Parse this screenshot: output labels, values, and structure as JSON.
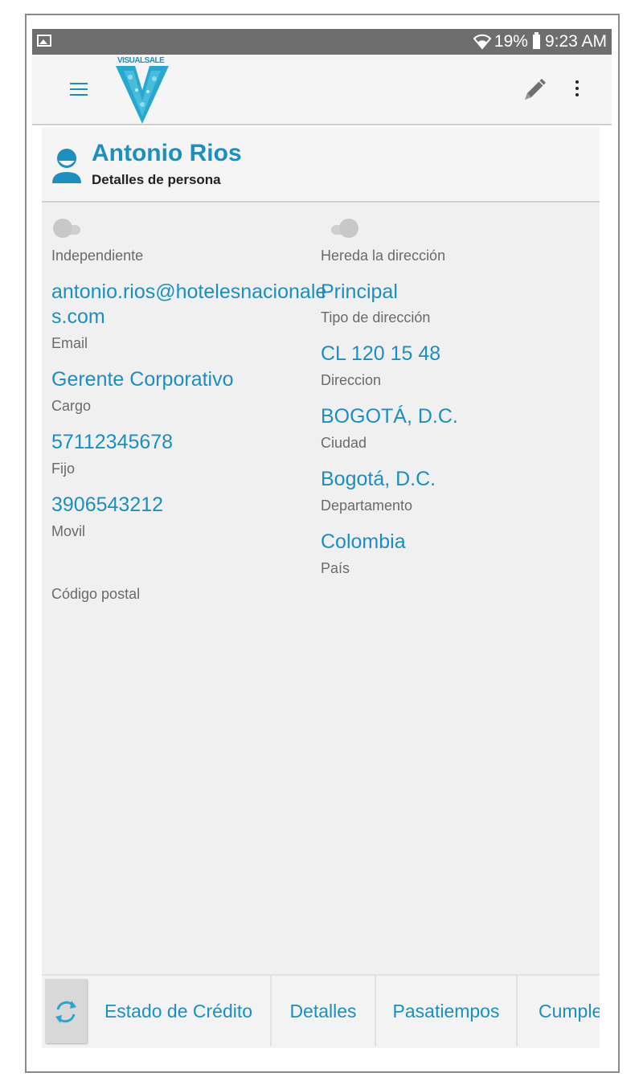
{
  "status_bar": {
    "battery_percent": "19%",
    "time": "9:23 AM"
  },
  "app_bar": {
    "logo_text": "VISUALSALE",
    "menu_icon": "hamburger-menu-icon",
    "edit_icon": "pencil-icon",
    "overflow_icon": "more-vert-icon"
  },
  "person": {
    "name": "Antonio Rios",
    "subtitle": "Detalles de persona"
  },
  "left_column": {
    "independiente_label": "Independiente",
    "independiente_on": false,
    "email_line1": "antonio.rios@hotelesnacionale",
    "email_line2": "s.com",
    "email_label": "Email",
    "cargo_value": "Gerente Corporativo",
    "cargo_label": "Cargo",
    "fijo_value": "57112345678",
    "fijo_label": "Fijo",
    "movil_value": "3906543212",
    "movil_label": "Movil",
    "codigo_postal_value": "",
    "codigo_postal_label": "Código postal"
  },
  "right_column": {
    "hereda_label": "Hereda la dirección",
    "hereda_on": false,
    "tipo_value": "Principal",
    "tipo_label": "Tipo de dirección",
    "direccion_value": "CL 120 15 48",
    "direccion_label": "Direccion",
    "ciudad_value": "BOGOTÁ, D.C.",
    "ciudad_label": "Ciudad",
    "departamento_value": "Bogotá, D.C.",
    "departamento_label": "Departamento",
    "pais_value": "Colombia",
    "pais_label": "País"
  },
  "bottom_tabs": {
    "refresh_icon": "refresh-icon",
    "items": [
      "Estado de Crédito",
      "Detalles",
      "Pasatiempos",
      "Cumpleaños"
    ]
  },
  "colors": {
    "accent": "#1b8fc0",
    "status_bar": "#6e6e6e",
    "background": "#f0f0f0"
  }
}
